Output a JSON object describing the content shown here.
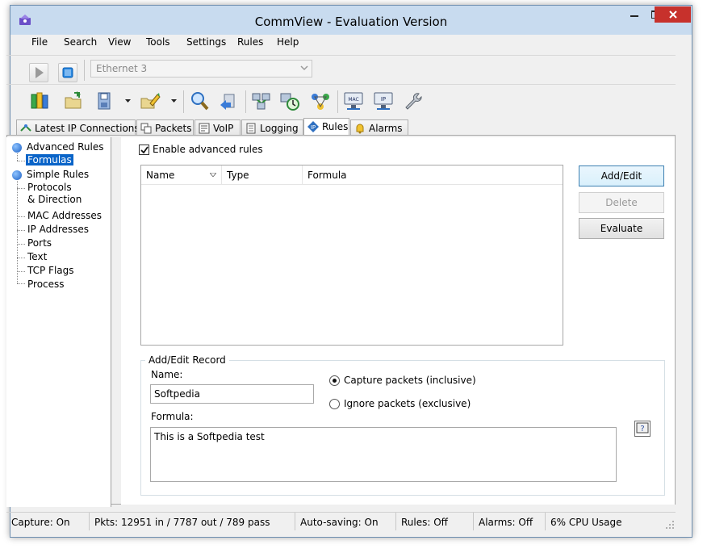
{
  "window": {
    "title": "CommView - Evaluation Version"
  },
  "menu": [
    "File",
    "Search",
    "View",
    "Tools",
    "Settings",
    "Rules",
    "Help"
  ],
  "toolbar": {
    "adapter": "Ethernet 3"
  },
  "tabs": [
    {
      "label": "Latest IP Connections",
      "icon": "ip-connections-icon"
    },
    {
      "label": "Packets",
      "icon": "packets-icon"
    },
    {
      "label": "VoIP",
      "icon": "voip-icon"
    },
    {
      "label": "Logging",
      "icon": "logging-icon"
    },
    {
      "label": "Rules",
      "icon": "rules-icon",
      "active": true
    },
    {
      "label": "Alarms",
      "icon": "alarms-icon"
    }
  ],
  "tree": {
    "advanced": "Advanced Rules",
    "formulas": "Formulas",
    "simple": "Simple Rules",
    "protocols_1": "Protocols",
    "protocols_2": "& Direction",
    "mac": "MAC Addresses",
    "ip": "IP Addresses",
    "ports": "Ports",
    "text": "Text",
    "tcp": "TCP Flags",
    "process": "Process"
  },
  "rules": {
    "enable_label": "Enable advanced rules",
    "enabled": true,
    "columns": [
      "Name",
      "Type",
      "Formula"
    ],
    "buttons": {
      "add_edit": "Add/Edit",
      "delete": "Delete",
      "evaluate": "Evaluate"
    }
  },
  "record": {
    "title": "Add/Edit Record",
    "name_label": "Name:",
    "name_value": "Softpedia",
    "formula_label": "Formula:",
    "formula_value": "This is a Softpedia test",
    "capture_label": "Capture packets (inclusive)",
    "ignore_label": "Ignore packets (exclusive)",
    "mode": "capture"
  },
  "status": {
    "capture": "Capture: On",
    "pkts": "Pkts: 12951 in / 7787 out / 789 pass",
    "autosave": "Auto-saving: On",
    "rules": "Rules: Off",
    "alarms": "Alarms: Off",
    "cpu": "6% CPU Usage"
  },
  "colors": {
    "titlebar": "#c8dbef",
    "close": "#c7312c",
    "selection": "#0a64c8"
  }
}
